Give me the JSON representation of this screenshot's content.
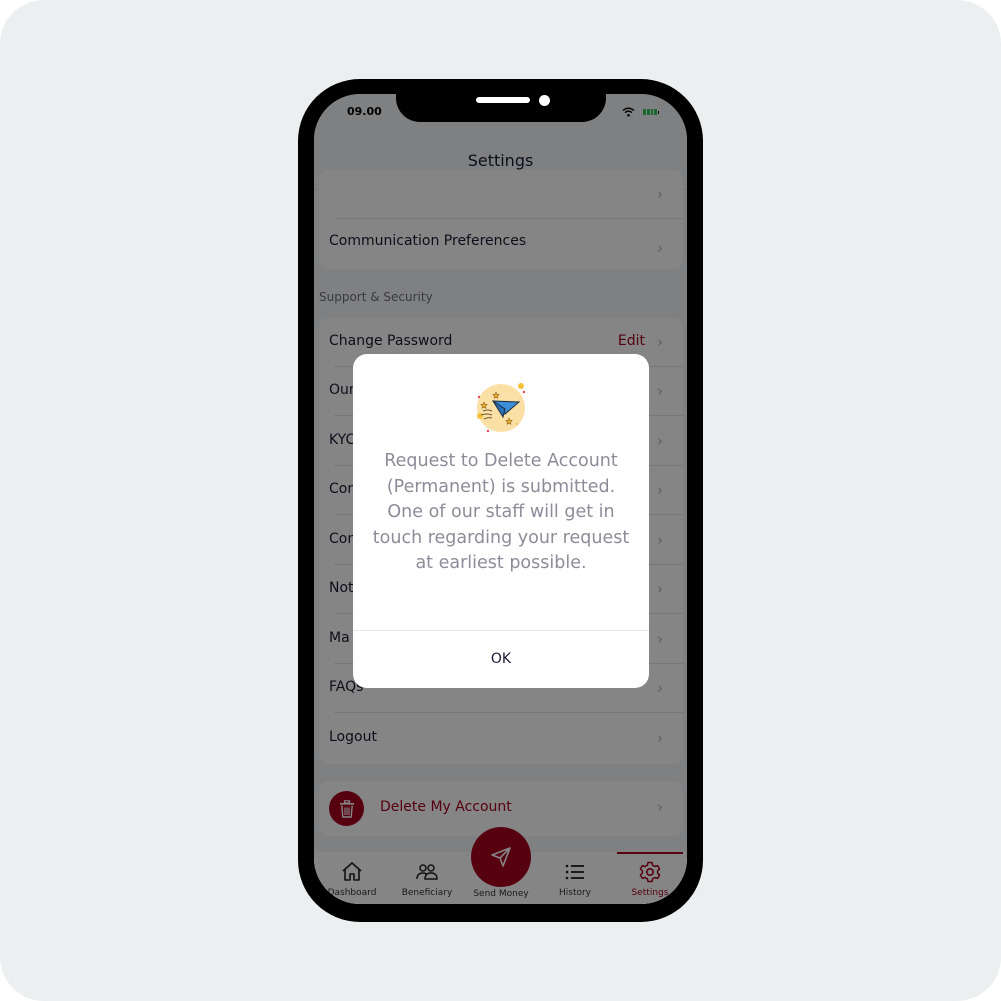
{
  "status_bar": {
    "time": "09.00",
    "wifi_icon": "wifi-icon",
    "battery_icon": "battery-icon"
  },
  "header": {
    "title": "Settings"
  },
  "preferences_card": {
    "items": [
      {
        "label": ""
      },
      {
        "label": "Communication Preferences"
      }
    ]
  },
  "support_section": {
    "title": "Support & Security",
    "items": [
      {
        "label": "Change Password",
        "action": "Edit"
      },
      {
        "label": "Our"
      },
      {
        "label": "KYC"
      },
      {
        "label": "Con"
      },
      {
        "label": "Con"
      },
      {
        "label": "Not"
      },
      {
        "label": "Ma"
      },
      {
        "label": "FAQs"
      },
      {
        "label": "Logout"
      }
    ]
  },
  "delete_account": {
    "label": "Delete My Account",
    "icon": "trash-icon"
  },
  "tabbar": {
    "tabs": [
      {
        "label": "Dashboard",
        "icon": "home-icon"
      },
      {
        "label": "Beneficiary",
        "icon": "users-icon"
      },
      {
        "label": "Send Money",
        "icon": "send-icon"
      },
      {
        "label": "History",
        "icon": "list-icon"
      },
      {
        "label": "Settings",
        "icon": "gear-icon",
        "active": true
      }
    ]
  },
  "modal": {
    "icon": "paper-plane-icon",
    "message": "Request to Delete Account (Permanent) is submitted. One of our staff will get in touch regarding your request at earliest possible.",
    "ok_label": "OK"
  },
  "colors": {
    "brand": "#a8001f",
    "overlay": "rgba(0,0,0,0.48)",
    "battery": "#34c759"
  }
}
